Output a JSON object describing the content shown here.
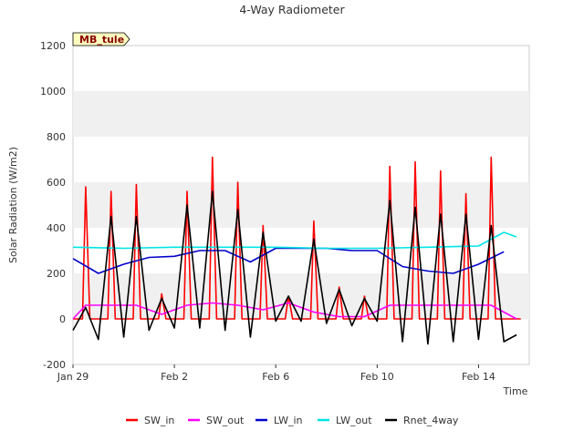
{
  "chart_data": {
    "type": "line",
    "title": "4-Way Radiometer",
    "xlabel": "Time",
    "ylabel": "Solar Radiation (W/m2)",
    "ylim": [
      -200,
      1200
    ],
    "xlim": [
      "2024-01-29",
      "2024-02-16"
    ],
    "yticks": [
      -200,
      0,
      200,
      400,
      600,
      800,
      1000,
      1200
    ],
    "xticks": [
      {
        "label": "Jan 29",
        "date": "2024-01-29"
      },
      {
        "label": "Feb 2",
        "date": "2024-02-02"
      },
      {
        "label": "Feb 6",
        "date": "2024-02-06"
      },
      {
        "label": "Feb 10",
        "date": "2024-02-10"
      },
      {
        "label": "Feb 14",
        "date": "2024-02-14"
      }
    ],
    "grid": "horizontal bands",
    "legend_position": "bottom",
    "annotation": "MB_tule",
    "series": [
      {
        "name": "SW_in",
        "color": "#ff0000",
        "x": [
          "2024-01-29 00:00",
          "2024-01-29 09:00",
          "2024-01-29 12:00",
          "2024-01-29 16:00",
          "2024-01-30 09:00",
          "2024-01-30 12:00",
          "2024-01-30 16:00",
          "2024-01-31 09:00",
          "2024-01-31 12:00",
          "2024-01-31 16:00",
          "2024-02-01 09:00",
          "2024-02-01 12:00",
          "2024-02-01 16:00",
          "2024-02-02 09:00",
          "2024-02-02 12:00",
          "2024-02-02 16:00",
          "2024-02-03 09:00",
          "2024-02-03 12:00",
          "2024-02-03 16:00",
          "2024-02-04 09:00",
          "2024-02-04 12:00",
          "2024-02-04 16:00",
          "2024-02-05 09:00",
          "2024-02-05 12:00",
          "2024-02-05 16:00",
          "2024-02-06 09:00",
          "2024-02-06 12:00",
          "2024-02-06 16:00",
          "2024-02-07 09:00",
          "2024-02-07 12:00",
          "2024-02-07 16:00",
          "2024-02-08 09:00",
          "2024-02-08 12:00",
          "2024-02-08 16:00",
          "2024-02-09 09:00",
          "2024-02-09 12:00",
          "2024-02-09 16:00",
          "2024-02-10 09:00",
          "2024-02-10 12:00",
          "2024-02-10 16:00",
          "2024-02-11 09:00",
          "2024-02-11 12:00",
          "2024-02-11 16:00",
          "2024-02-12 09:00",
          "2024-02-12 12:00",
          "2024-02-12 16:00",
          "2024-02-13 09:00",
          "2024-02-13 12:00",
          "2024-02-13 16:00",
          "2024-02-14 09:00",
          "2024-02-14 12:00",
          "2024-02-14 16:00",
          "2024-02-15 09:00",
          "2024-02-15 12:00",
          "2024-02-15 16:00"
        ],
        "y": [
          0,
          0,
          580,
          0,
          0,
          560,
          0,
          0,
          590,
          0,
          0,
          110,
          0,
          0,
          560,
          0,
          0,
          710,
          0,
          0,
          600,
          0,
          0,
          410,
          0,
          0,
          100,
          0,
          0,
          430,
          0,
          0,
          140,
          0,
          0,
          100,
          0,
          0,
          670,
          0,
          0,
          690,
          0,
          0,
          650,
          0,
          0,
          550,
          0,
          0,
          710,
          0,
          0,
          0,
          0
        ]
      },
      {
        "name": "SW_out",
        "color": "#ff00ff",
        "x": [
          "2024-01-29 00:00",
          "2024-01-29 12:00",
          "2024-01-30 12:00",
          "2024-01-31 12:00",
          "2024-02-01 12:00",
          "2024-02-02 12:00",
          "2024-02-03 12:00",
          "2024-02-04 12:00",
          "2024-02-05 12:00",
          "2024-02-06 12:00",
          "2024-02-07 12:00",
          "2024-02-08 12:00",
          "2024-02-09 12:00",
          "2024-02-10 12:00",
          "2024-02-11 12:00",
          "2024-02-12 12:00",
          "2024-02-13 12:00",
          "2024-02-14 12:00",
          "2024-02-15 12:00"
        ],
        "y": [
          0,
          60,
          60,
          60,
          20,
          60,
          70,
          60,
          40,
          70,
          30,
          10,
          10,
          60,
          60,
          60,
          60,
          60,
          0
        ]
      },
      {
        "name": "LW_in",
        "color": "#0000cc",
        "x": [
          "2024-01-29 00:00",
          "2024-01-30 00:00",
          "2024-01-31 00:00",
          "2024-02-01 00:00",
          "2024-02-02 00:00",
          "2024-02-03 00:00",
          "2024-02-04 00:00",
          "2024-02-05 00:00",
          "2024-02-06 00:00",
          "2024-02-07 00:00",
          "2024-02-08 00:00",
          "2024-02-09 00:00",
          "2024-02-10 00:00",
          "2024-02-11 00:00",
          "2024-02-12 00:00",
          "2024-02-13 00:00",
          "2024-02-14 00:00",
          "2024-02-15 00:00"
        ],
        "y": [
          265,
          200,
          240,
          270,
          275,
          300,
          300,
          250,
          310,
          310,
          310,
          300,
          300,
          230,
          210,
          200,
          240,
          295
        ]
      },
      {
        "name": "LW_out",
        "color": "#00e5e5",
        "x": [
          "2024-01-29 00:00",
          "2024-01-31 00:00",
          "2024-02-02 00:00",
          "2024-02-04 00:00",
          "2024-02-06 00:00",
          "2024-02-08 00:00",
          "2024-02-10 00:00",
          "2024-02-12 00:00",
          "2024-02-14 00:00",
          "2024-02-15 00:00",
          "2024-02-15 12:00"
        ],
        "y": [
          315,
          310,
          315,
          315,
          315,
          310,
          310,
          315,
          320,
          380,
          360
        ]
      },
      {
        "name": "Rnet_4way",
        "color": "#000000",
        "x": [
          "2024-01-29 00:00",
          "2024-01-29 12:00",
          "2024-01-30 00:00",
          "2024-01-30 12:00",
          "2024-01-31 00:00",
          "2024-01-31 12:00",
          "2024-02-01 00:00",
          "2024-02-01 12:00",
          "2024-02-02 00:00",
          "2024-02-02 12:00",
          "2024-02-03 00:00",
          "2024-02-03 12:00",
          "2024-02-04 00:00",
          "2024-02-04 12:00",
          "2024-02-05 00:00",
          "2024-02-05 12:00",
          "2024-02-06 00:00",
          "2024-02-06 12:00",
          "2024-02-07 00:00",
          "2024-02-07 12:00",
          "2024-02-08 00:00",
          "2024-02-08 12:00",
          "2024-02-09 00:00",
          "2024-02-09 12:00",
          "2024-02-10 00:00",
          "2024-02-10 12:00",
          "2024-02-11 00:00",
          "2024-02-11 12:00",
          "2024-02-12 00:00",
          "2024-02-12 12:00",
          "2024-02-13 00:00",
          "2024-02-13 12:00",
          "2024-02-14 00:00",
          "2024-02-14 12:00",
          "2024-02-15 00:00",
          "2024-02-15 12:00"
        ],
        "y": [
          -50,
          50,
          -90,
          450,
          -80,
          450,
          -50,
          90,
          -40,
          500,
          -40,
          560,
          -50,
          480,
          -80,
          380,
          -10,
          100,
          -10,
          350,
          -20,
          130,
          -30,
          90,
          -10,
          520,
          -100,
          490,
          -110,
          460,
          -100,
          460,
          -90,
          410,
          -100,
          -70
        ]
      }
    ]
  }
}
